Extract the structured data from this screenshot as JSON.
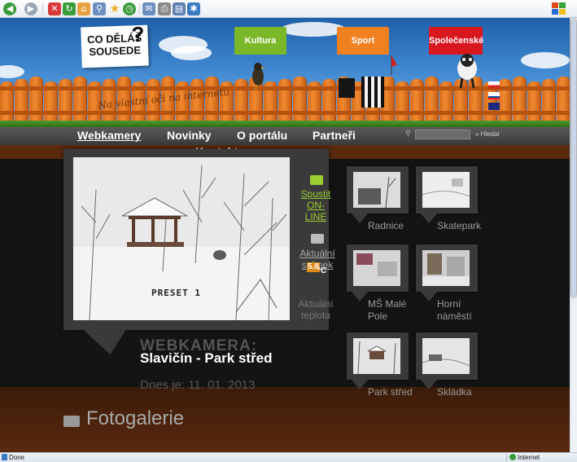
{
  "browser": {
    "status_text": "Done",
    "zone_text": "Internet"
  },
  "header": {
    "logo_line1": "CO DĚLÁŠ",
    "logo_line2": "SOUSEDE",
    "logo_mark": "?",
    "category_culture": "Kultura",
    "category_sport": "Sport",
    "category_social": "Společenské",
    "fence_slogan": "Na vlastní oči na internetu"
  },
  "nav": {
    "items": [
      "Webkamery",
      "Novinky",
      "O portálu",
      "Partneři",
      "Kontakt"
    ],
    "search_button": "» Hledat"
  },
  "webcam": {
    "overlay_text": "PRESET  1",
    "start_online": "Spustit ON-LINE",
    "current_snapshot": "Aktuální snímek",
    "temperature_value": "5.8",
    "temperature_unit": "°C",
    "temperature_label": "Aktuální teplota",
    "title": "WEBKAMERA:",
    "name": "Slavičín - Park střed",
    "date": "Dnes je: 11. 01. 2013"
  },
  "thumbnails": [
    {
      "label": "Radnice"
    },
    {
      "label": "Skatepark"
    },
    {
      "label": "MŠ Malé Pole"
    },
    {
      "label": "Horní náměstí"
    },
    {
      "label": "Park střed"
    },
    {
      "label": "Skládka"
    }
  ],
  "gallery": {
    "title": "Fotogalerie"
  },
  "colors": {
    "accent_green": "#7ab829",
    "link_green": "#9acd32",
    "brown": "#5a2a0d"
  }
}
